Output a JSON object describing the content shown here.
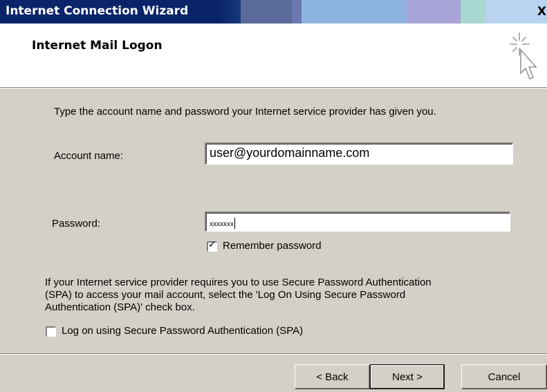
{
  "window": {
    "title": "Internet Connection Wizard",
    "close_label": "X"
  },
  "header": {
    "title": "Internet Mail Logon",
    "icon": "wizard-cursor-sparkle-icon"
  },
  "intro_text": "Type the account name and password your Internet service provider has given you.",
  "account": {
    "label": "Account name:",
    "value": "user@yourdomainname.com"
  },
  "password": {
    "label": "Password:",
    "value": "xxxxxxx"
  },
  "remember_password": {
    "label": "Remember password",
    "checked": true,
    "check_glyph": "✓"
  },
  "spa": {
    "paragraph": [
      "If your Internet service provider requires you to use Secure Password Authentication",
      "(SPA) to access your mail account, select the 'Log On Using Secure Password",
      "Authentication (SPA)' check box."
    ],
    "checkbox_label": "Log on using Secure Password Authentication (SPA)",
    "checked": false
  },
  "buttons": {
    "back": "< Back",
    "next": "Next >",
    "cancel": "Cancel"
  },
  "colors": {
    "title_bar": "#0a246a",
    "face": "#d4d0c8",
    "header_bg": "#ffffff"
  }
}
